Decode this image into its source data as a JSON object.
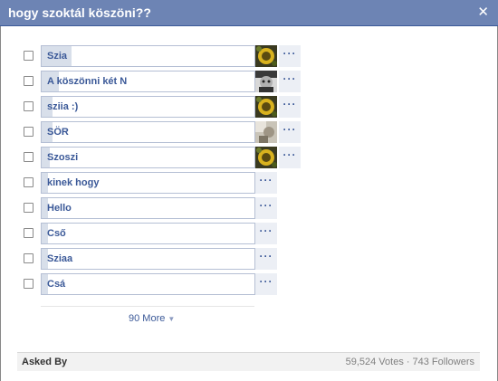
{
  "dialog": {
    "title": "hogy szoktál köszöni??",
    "close_label": "✕"
  },
  "options": [
    {
      "label": "Szia",
      "fill": 0.14,
      "avatar": "avatar-sunflower",
      "more": "···"
    },
    {
      "label": "A köszönni két N",
      "fill": 0.08,
      "avatar": "avatar-dark-face",
      "more": "···"
    },
    {
      "label": "sziia :)",
      "fill": 0.05,
      "avatar": "avatar-sunflower",
      "more": "···"
    },
    {
      "label": "SÖR",
      "fill": 0.05,
      "avatar": "avatar-light-photo",
      "more": "···"
    },
    {
      "label": "Szoszi",
      "fill": 0.04,
      "avatar": "avatar-sunflower",
      "more": "···"
    },
    {
      "label": "kinek hogy",
      "fill": 0.03,
      "avatar": null,
      "more": "···"
    },
    {
      "label": "Hello",
      "fill": 0.03,
      "avatar": null,
      "more": "···"
    },
    {
      "label": "Cső",
      "fill": 0.03,
      "avatar": null,
      "more": "···"
    },
    {
      "label": "Sziaa",
      "fill": 0.03,
      "avatar": null,
      "more": "···"
    },
    {
      "label": "Csá",
      "fill": 0.03,
      "avatar": null,
      "more": "···"
    }
  ],
  "more_link": {
    "label": "90 More"
  },
  "footer": {
    "asked_by": "Asked By",
    "votes": "59,524 Votes",
    "separator": "·",
    "followers": "743 Followers"
  },
  "colors": {
    "titlebar": "#6d84b4",
    "link": "#3b5998",
    "bar_fill": "#d8dfea",
    "bar_border": "#b5bfd4"
  }
}
